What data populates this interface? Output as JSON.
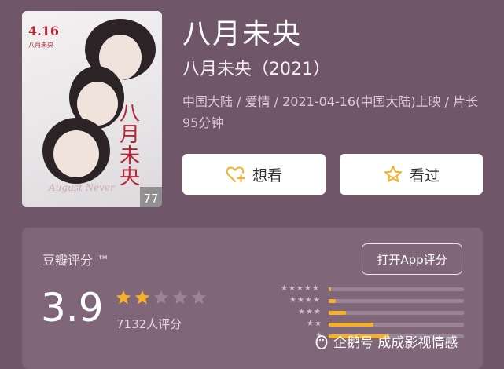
{
  "poster": {
    "date_text": "4.16",
    "sub_text": "八月未央",
    "title_vertical": "八月未央",
    "script_text": "August Never",
    "badge_score": "77"
  },
  "movie": {
    "title": "八月未央",
    "subtitle": "八月未央（2021）",
    "meta": "中国大陆 / 爱情 / 2021-04-16(中国大陆)上映 / 片长95分钟"
  },
  "actions": {
    "want_label": "想看",
    "want_icon": "heart-plus-icon",
    "seen_label": "看过",
    "seen_icon": "star-outline-icon"
  },
  "rating": {
    "label": "豆瓣评分 ™",
    "open_app_label": "打开App评分",
    "score": "3.9",
    "stars_filled": 2,
    "stars_total": 5,
    "count_text": "7132人评分",
    "distribution": [
      {
        "stars": "★★★★★",
        "fraction": 0.02
      },
      {
        "stars": "★★★★",
        "fraction": 0.05
      },
      {
        "stars": "★★★",
        "fraction": 0.13
      },
      {
        "stars": "★★",
        "fraction": 0.33
      },
      {
        "stars": "★",
        "fraction": 0.45
      }
    ]
  },
  "watermark": {
    "text": "企鹅号 成成影视情感",
    "icon": "penguin-icon"
  },
  "colors": {
    "background": "#6f5668",
    "panel": "#7f6678",
    "star": "#f5b12a",
    "star_empty": "#9a8596"
  }
}
